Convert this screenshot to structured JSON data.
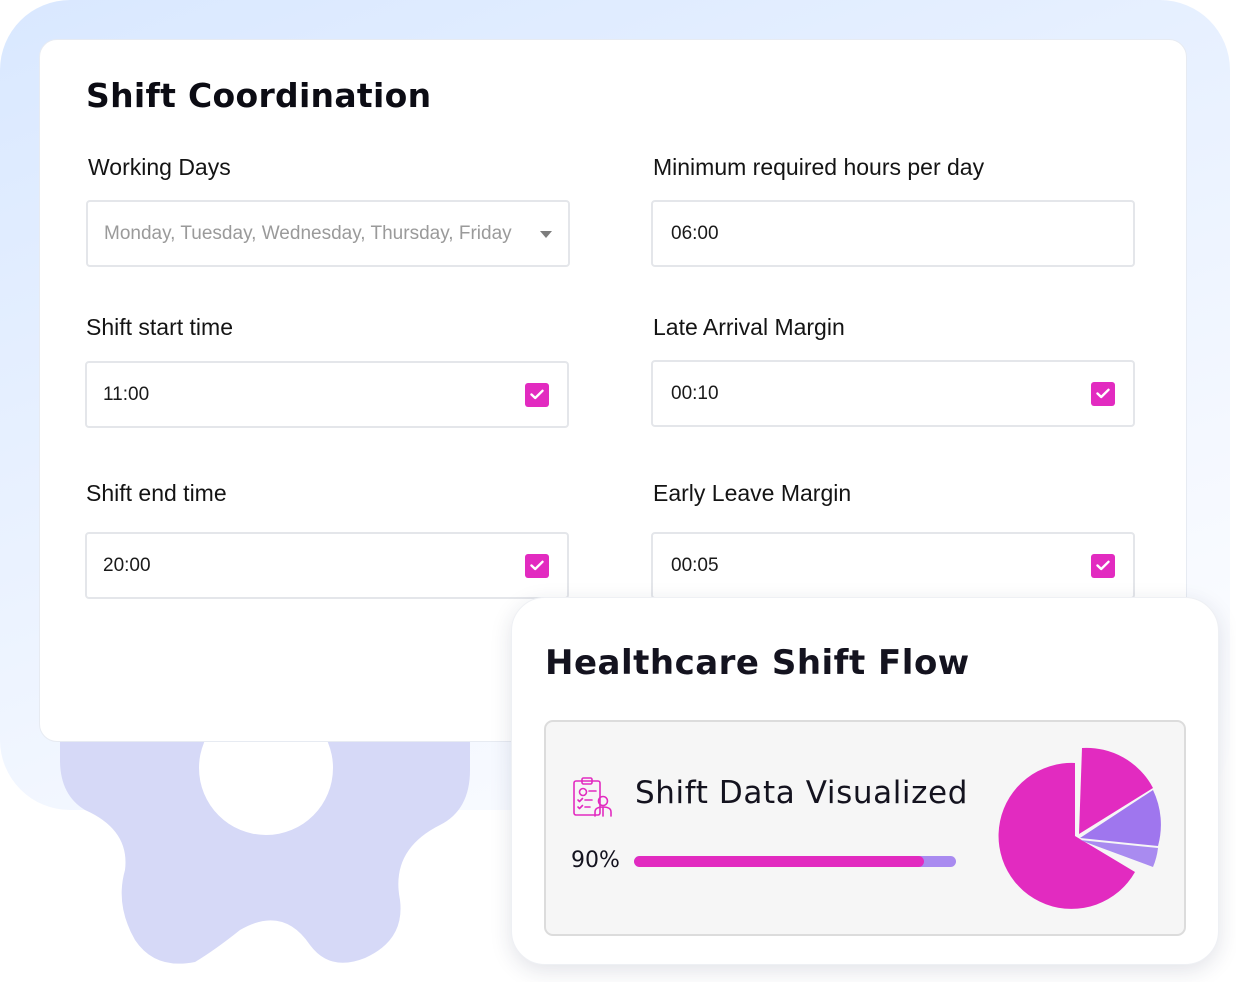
{
  "shift_coordination": {
    "title": "Shift Coordination",
    "working_days": {
      "label": "Working Days",
      "placeholder": "Monday, Tuesday, Wednesday, Thursday, Friday"
    },
    "min_hours": {
      "label": "Minimum required hours per day",
      "value": "06:00"
    },
    "shift_start": {
      "label": "Shift start time",
      "value": "11:00",
      "checked": true
    },
    "late_arrival": {
      "label": "Late Arrival Margin",
      "value": "00:10",
      "checked": true
    },
    "shift_end": {
      "label": "Shift end time",
      "value": "20:00",
      "checked": true
    },
    "early_leave": {
      "label": "Early Leave Margin",
      "value": "00:05",
      "checked": true
    }
  },
  "healthcare_flow": {
    "title": "Healthcare Shift Flow",
    "viz_title": "Shift Data Visualized",
    "progress_label": "90%",
    "progress_value": 0.9,
    "icon": "clipboard-doctor-icon"
  },
  "colors": {
    "accent": "#e22bc0",
    "secondary": "#a98bf0",
    "gear": "#d6d9f7"
  }
}
